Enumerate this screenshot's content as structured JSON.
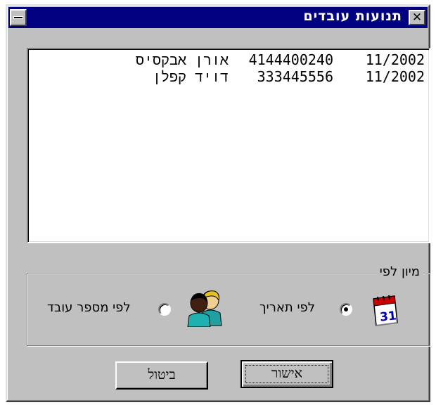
{
  "window": {
    "title": "תנועות עובדים",
    "close_label": "✕"
  },
  "records": [
    {
      "name": "אורן אבקסיס",
      "number": "4144400240",
      "date": "11/2002"
    },
    {
      "name": "דויד קפלן",
      "number": "333445556",
      "date": "11/2002"
    }
  ],
  "sort_group": {
    "legend": "מיון לפי",
    "options": [
      {
        "label": "לפי תאריך",
        "selected": true,
        "icon": "calendar-icon"
      },
      {
        "label": "לפי מספר עובד",
        "selected": false,
        "icon": "employees-icon"
      }
    ]
  },
  "buttons": {
    "ok_label": "אישור",
    "cancel_label": "ביטול"
  },
  "colors": {
    "titlebar": "#000080",
    "face": "#c0c0c0",
    "calendar_red": "#cc0000",
    "calendar_blue": "#0000c0"
  }
}
